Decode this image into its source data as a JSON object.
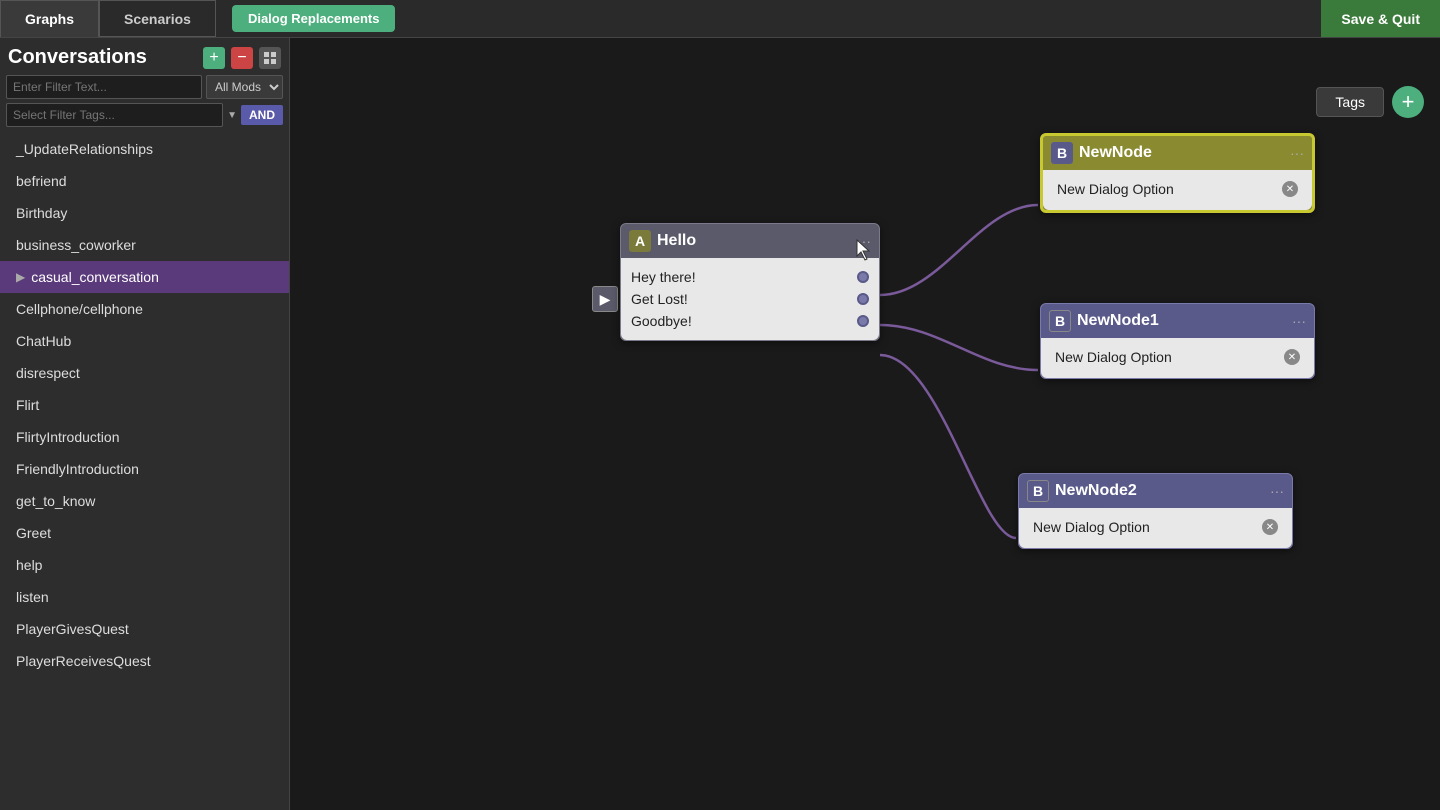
{
  "topbar": {
    "tab_graphs": "Graphs",
    "tab_scenarios": "Scenarios",
    "dialog_replacements": "Dialog Replacements",
    "save_quit": "Save & Quit"
  },
  "sidebar": {
    "title": "Conversations",
    "add_icon": "+",
    "minus_icon": "−",
    "grid_icon": "⊞",
    "filter_placeholder": "Enter Filter Text...",
    "mods_label": "All Mods",
    "tags_placeholder": "Select Filter Tags...",
    "and_label": "AND",
    "items": [
      {
        "label": "_UpdateRelationships",
        "active": false
      },
      {
        "label": "befriend",
        "active": false
      },
      {
        "label": "Birthday",
        "active": false
      },
      {
        "label": "business_coworker",
        "active": false
      },
      {
        "label": "casual_conversation",
        "active": true
      },
      {
        "label": "Cellphone/cellphone",
        "active": false
      },
      {
        "label": "ChatHub",
        "active": false
      },
      {
        "label": "disrespect",
        "active": false
      },
      {
        "label": "Flirt",
        "active": false
      },
      {
        "label": "FlirtyIntroduction",
        "active": false
      },
      {
        "label": "FriendlyIntroduction",
        "active": false
      },
      {
        "label": "get_to_know",
        "active": false
      },
      {
        "label": "Greet",
        "active": false
      },
      {
        "label": "help",
        "active": false
      },
      {
        "label": "listen",
        "active": false
      },
      {
        "label": "PlayerGivesQuest",
        "active": false
      },
      {
        "label": "PlayerReceivesQuest",
        "active": false
      }
    ]
  },
  "tags": {
    "label": "Tags",
    "add_icon": "+"
  },
  "nodes": {
    "node_a": {
      "letter": "A",
      "title": "Hello",
      "menu": "···",
      "options": [
        {
          "label": "Hey there!"
        },
        {
          "label": "Get Lost!"
        },
        {
          "label": "Goodbye!"
        }
      ]
    },
    "node_b1": {
      "letter": "B",
      "title": "NewNode",
      "menu": "···",
      "dialog_option": "New Dialog Option"
    },
    "node_b2": {
      "letter": "B",
      "title": "NewNode1",
      "menu": "···",
      "dialog_option": "New Dialog Option"
    },
    "node_b3": {
      "letter": "B",
      "title": "NewNode2",
      "menu": "···",
      "dialog_option": "New Dialog Option"
    }
  }
}
